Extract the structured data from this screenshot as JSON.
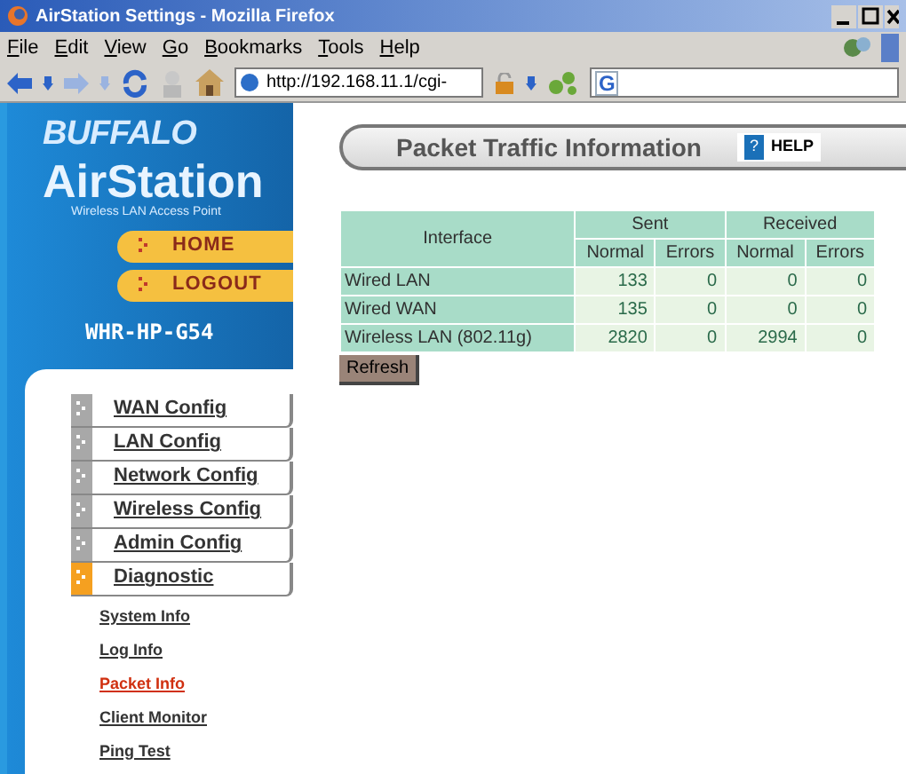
{
  "window": {
    "title": "AirStation Settings - Mozilla Firefox"
  },
  "menu": [
    {
      "label": "File"
    },
    {
      "label": "Edit"
    },
    {
      "label": "View"
    },
    {
      "label": "Go"
    },
    {
      "label": "Bookmarks"
    },
    {
      "label": "Tools"
    },
    {
      "label": "Help"
    }
  ],
  "address": {
    "value": "http://192.168.11.1/cgi-"
  },
  "search": {
    "value": "G"
  },
  "brand": {
    "logo": "BUFFALO",
    "product": "AirStation",
    "tagline": "Wireless LAN Access Point",
    "model": "WHR-HP-G54"
  },
  "top_buttons": [
    "HOME",
    "LOGOUT"
  ],
  "nav": [
    {
      "label": "WAN Config",
      "selected": false
    },
    {
      "label": "LAN Config",
      "selected": false
    },
    {
      "label": "Network Config",
      "selected": false
    },
    {
      "label": "Wireless Config",
      "selected": false
    },
    {
      "label": "Admin Config",
      "selected": false
    },
    {
      "label": "Diagnostic",
      "selected": true
    }
  ],
  "subnav": [
    {
      "label": "System Info",
      "selected": false
    },
    {
      "label": "Log Info",
      "selected": false
    },
    {
      "label": "Packet Info",
      "selected": true
    },
    {
      "label": "Client Monitor",
      "selected": false
    },
    {
      "label": "Ping Test",
      "selected": false
    }
  ],
  "page": {
    "title": "Packet Traffic Information",
    "help": "HELP",
    "help_mark": "?"
  },
  "table": {
    "interface_header": "Interface",
    "groups": [
      "Sent",
      "Received"
    ],
    "subheaders": [
      "Normal",
      "Errors",
      "Normal",
      "Errors"
    ],
    "rows": [
      {
        "name": "Wired LAN",
        "values": [
          "133",
          "0",
          "0",
          "0"
        ]
      },
      {
        "name": "Wired WAN",
        "values": [
          "135",
          "0",
          "0",
          "0"
        ]
      },
      {
        "name": "Wireless LAN (802.11g)",
        "values": [
          "2820",
          "0",
          "2994",
          "0"
        ]
      }
    ]
  },
  "refresh": "Refresh"
}
